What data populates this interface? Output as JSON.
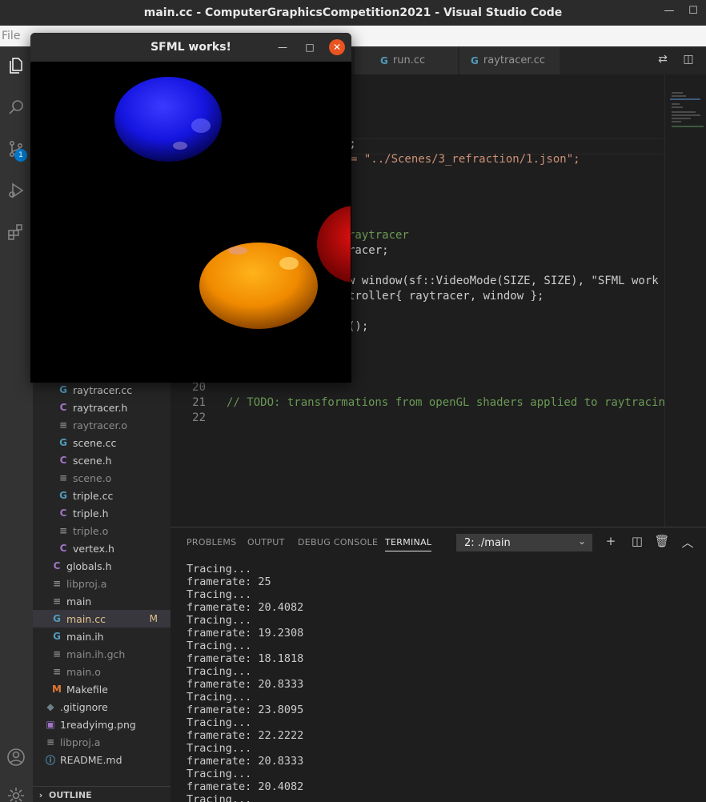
{
  "window": {
    "title": "main.cc - ComputerGraphicsCompetition2021 - Visual Studio Code"
  },
  "menu": {
    "items": [
      "File"
    ]
  },
  "activity_bar": {
    "icons": [
      "explorer-icon",
      "search-icon",
      "source-control-icon",
      "run-debug-icon",
      "extensions-icon",
      "account-icon",
      "manage-gear-icon"
    ],
    "scm_badge": "1",
    "accent": "#007acc"
  },
  "sidebar": {
    "items": [
      {
        "label": "raytracer.cc",
        "icon": "cpp",
        "dim": false
      },
      {
        "label": "raytracer.h",
        "icon": "c",
        "dim": false
      },
      {
        "label": "raytracer.o",
        "icon": "txt",
        "dim": true
      },
      {
        "label": "scene.cc",
        "icon": "cpp",
        "dim": false
      },
      {
        "label": "scene.h",
        "icon": "c",
        "dim": false
      },
      {
        "label": "scene.o",
        "icon": "txt",
        "dim": true
      },
      {
        "label": "triple.cc",
        "icon": "cpp",
        "dim": false
      },
      {
        "label": "triple.h",
        "icon": "c",
        "dim": false
      },
      {
        "label": "triple.o",
        "icon": "txt",
        "dim": true
      },
      {
        "label": "vertex.h",
        "icon": "c",
        "dim": false
      },
      {
        "label": "globals.h",
        "icon": "c",
        "dim": false
      },
      {
        "label": "libproj.a",
        "icon": "txt",
        "dim": true
      },
      {
        "label": "main",
        "icon": "txt",
        "dim": false
      },
      {
        "label": "main.cc",
        "icon": "cpp",
        "dim": false,
        "modified": "M"
      },
      {
        "label": "main.ih",
        "icon": "cpp",
        "dim": false
      },
      {
        "label": "main.ih.gch",
        "icon": "txt",
        "dim": true
      },
      {
        "label": "main.o",
        "icon": "txt",
        "dim": true
      },
      {
        "label": "Makefile",
        "icon": "make",
        "dim": false
      },
      {
        "label": ".gitignore",
        "icon": "git",
        "dim": false
      },
      {
        "label": "1readyimg.png",
        "icon": "img",
        "dim": false
      },
      {
        "label": "libproj.a",
        "icon": "txt",
        "dim": true
      },
      {
        "label": "README.md",
        "icon": "info",
        "dim": false
      }
    ],
    "outline_label": "OUTLINE"
  },
  "tabs": [
    {
      "label": "run.cc"
    },
    {
      "label": "raytracer.cc"
    }
  ],
  "editor": {
    "fragments": [
      {
        "text": ");",
        "cls": "c-plain"
      },
      {
        "text": "= \"../Scenes/3_refraction/1.json\";",
        "cls": "c-str"
      },
      {
        "text": "raytracer",
        "cls": "c-cmt"
      },
      {
        "text": "racer;",
        "cls": "c-plain"
      },
      {
        "text": "w window(sf::VideoMode(SIZE, SIZE), \"SFML work",
        "cls": "c-plain"
      },
      {
        "text": "troller{ raytracer, window };",
        "cls": "c-plain"
      },
      {
        "text": "();",
        "cls": "c-plain"
      }
    ],
    "lines": [
      {
        "num": "20",
        "text": ""
      },
      {
        "num": "21",
        "text": "// TODO: transformations from openGL shaders applied to raytracin"
      },
      {
        "num": "22",
        "text": ""
      }
    ]
  },
  "panel": {
    "tabs": [
      "PROBLEMS",
      "OUTPUT",
      "DEBUG CONSOLE",
      "TERMINAL"
    ],
    "active_tab": "TERMINAL",
    "terminal_select": "2: ./main",
    "terminal_lines": [
      "Tracing...",
      "framerate: 25",
      "Tracing...",
      "framerate: 20.4082",
      "Tracing...",
      "framerate: 19.2308",
      "Tracing...",
      "framerate: 18.1818",
      "Tracing...",
      "framerate: 20.8333",
      "Tracing...",
      "framerate: 23.8095",
      "Tracing...",
      "framerate: 22.2222",
      "Tracing...",
      "framerate: 20.8333",
      "Tracing...",
      "framerate: 20.4082",
      "Tracing..."
    ]
  },
  "sfml_window": {
    "title": "SFML works!",
    "close_color": "#e95420"
  }
}
